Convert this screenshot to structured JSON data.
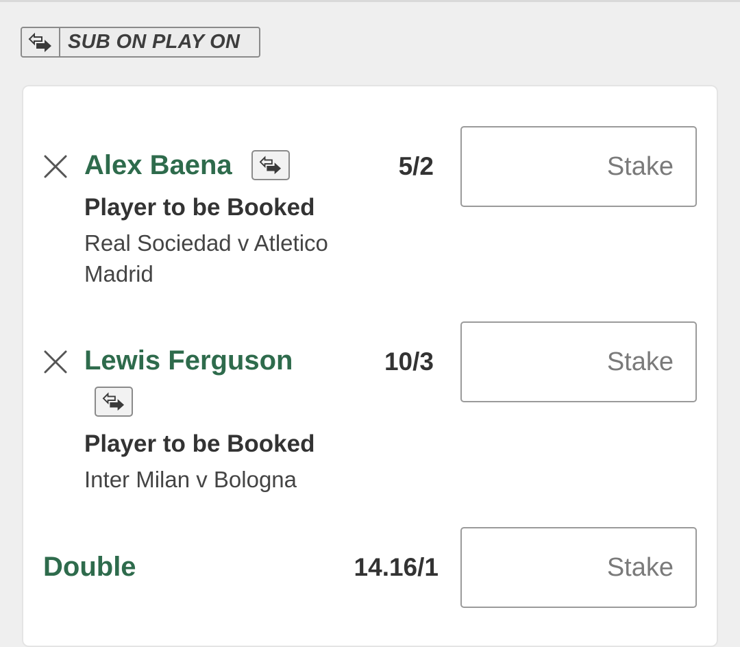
{
  "header": {
    "badge_label": "SUB ON PLAY ON",
    "badge_icon": "sub-swap-icon"
  },
  "selections": [
    {
      "name": "Alex Baena",
      "market": "Player to be Booked",
      "event_line1": "Real Sociedad v Atletico",
      "event_line2": "Madrid",
      "odds": "5/2",
      "stake_placeholder": "Stake"
    },
    {
      "name": "Lewis Ferguson",
      "market": "Player to be Booked",
      "event_line1": "Inter Milan v Bologna",
      "odds": "10/3",
      "stake_placeholder": "Stake"
    }
  ],
  "multiple": {
    "label": "Double",
    "odds": "14.16/1",
    "stake_placeholder": "Stake"
  },
  "colors": {
    "brand_green": "#2e6b4c",
    "text_dark": "#333333",
    "border_gray": "#9a9a9a",
    "page_bg": "#efefef"
  }
}
